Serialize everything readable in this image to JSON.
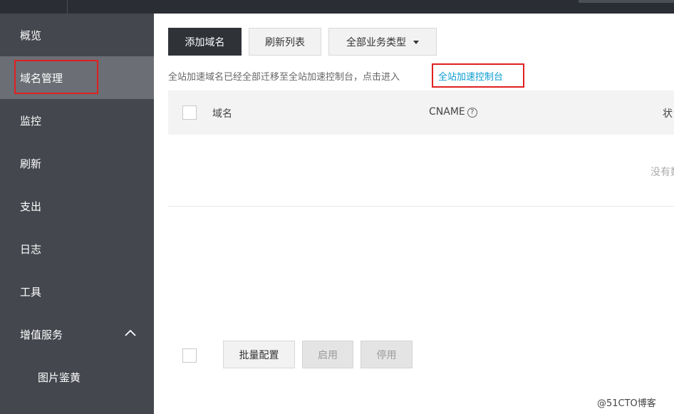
{
  "sidebar": {
    "items": [
      {
        "label": "概览"
      },
      {
        "label": "域名管理"
      },
      {
        "label": "监控"
      },
      {
        "label": "刷新"
      },
      {
        "label": "支出"
      },
      {
        "label": "日志"
      },
      {
        "label": "工具"
      },
      {
        "label": "增值服务",
        "expanded": true,
        "icon": "chevron-up-icon"
      },
      {
        "label": "图片鉴黄"
      }
    ],
    "active_index": 1
  },
  "toolbar": {
    "add_domain": "添加域名",
    "refresh_list": "刷新列表",
    "business_type": "全部业务类型"
  },
  "notice": {
    "text": "全站加速域名已经全部迁移至全站加速控制台，点击进入",
    "link": "全站加速控制台"
  },
  "table": {
    "columns": [
      "域名",
      "CNAME",
      "状"
    ],
    "empty_text": "没有数"
  },
  "footer": {
    "batch_config": "批量配置",
    "enable": "启用",
    "disable": "停用"
  },
  "watermark": "@51CTO博客",
  "colors": {
    "sidebar_bg": "#44474e",
    "sidebar_active": "#6b6e74",
    "primary_button": "#2f3237",
    "link": "#0a9bd0",
    "highlight": "#e02020"
  }
}
